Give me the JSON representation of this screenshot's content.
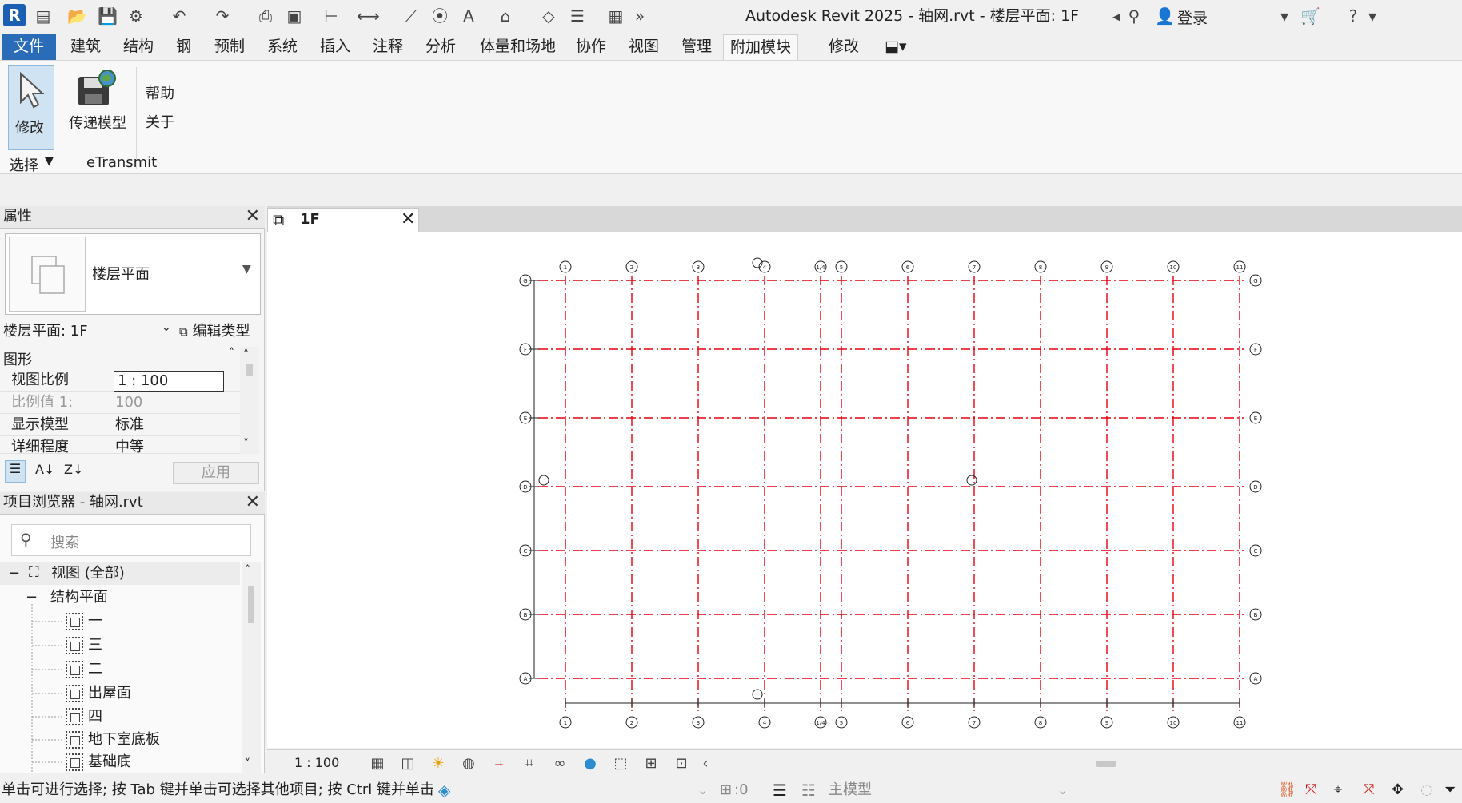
{
  "window": {
    "title": "Autodesk Revit 2025 - 轴网.rvt - 楼层平面: 1F",
    "logo": "R",
    "login": "登录"
  },
  "ribbon_tabs": [
    "文件",
    "建筑",
    "结构",
    "钢",
    "预制",
    "系统",
    "插入",
    "注释",
    "分析",
    "体量和场地",
    "协作",
    "视图",
    "管理",
    "附加模块",
    "修改"
  ],
  "ribbon": {
    "modify_label": "修改",
    "transmit_label": "传递模型",
    "help_label": "帮助",
    "about_label": "关于",
    "select_panel": "选择",
    "etransmit_panel": "eTransmit"
  },
  "properties": {
    "title": "属性",
    "type_name": "楼层平面",
    "instance_filter": "楼层平面: 1F",
    "edit_type": "编辑类型",
    "group": "图形",
    "rows": [
      {
        "k": "视图比例",
        "v": "1 : 100"
      },
      {
        "k": "比例值 1:",
        "v": "100"
      },
      {
        "k": "显示模型",
        "v": "标准"
      },
      {
        "k": "详细程度",
        "v": "中等"
      }
    ],
    "apply": "应用"
  },
  "browser": {
    "title": "项目浏览器 - 轴网.rvt",
    "search_placeholder": "搜索",
    "root": "视图 (全部)",
    "group": "结构平面",
    "items": [
      "一",
      "三",
      "二",
      "出屋面",
      "四",
      "地下室底板",
      "基础底"
    ]
  },
  "view": {
    "tab_label": "1F",
    "scale": "1 : 100",
    "vertical_grids": [
      "1",
      "2",
      "3",
      "4",
      "1/4",
      "5",
      "6",
      "7",
      "8",
      "9",
      "10",
      "11"
    ],
    "horizontal_grids": [
      "G",
      "F",
      "E",
      "D",
      "C",
      "B",
      "A"
    ],
    "grid_color": "#e8000f"
  },
  "status": {
    "message": "单击可进行选择; 按 Tab 键并单击可选择其他项目; 按 Ctrl 键并单击可",
    "selection_count": ":0",
    "model": "主模型"
  }
}
